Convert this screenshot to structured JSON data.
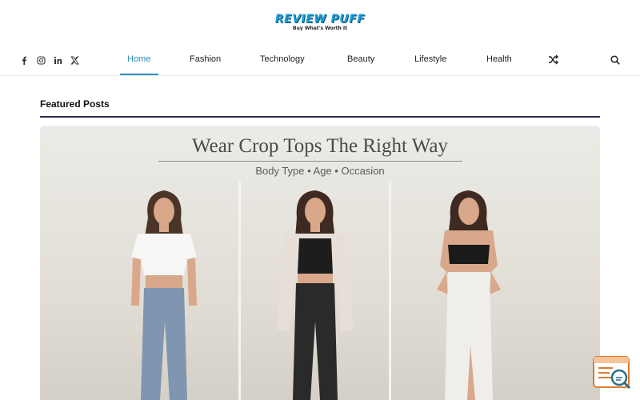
{
  "logo": {
    "name": "REVIEW PUFF",
    "tagline": "Buy What's Worth It"
  },
  "social": [
    {
      "icon": "facebook-icon"
    },
    {
      "icon": "instagram-icon"
    },
    {
      "icon": "linkedin-icon"
    },
    {
      "icon": "x-twitter-icon"
    }
  ],
  "nav": [
    {
      "label": "Home",
      "active": true
    },
    {
      "label": "Fashion"
    },
    {
      "label": "Technology"
    },
    {
      "label": "Beauty"
    },
    {
      "label": "Lifestyle"
    },
    {
      "label": "Health"
    }
  ],
  "section": {
    "title": "Featured Posts"
  },
  "hero": {
    "title": "Wear Crop Tops The Right Way",
    "subtitle": "Body Type • Age • Occasion"
  },
  "colors": {
    "accent": "#2a8fbf",
    "rule": "#2b2f4a",
    "logo": "#1f9fd8",
    "widget": "#e07a2e"
  }
}
